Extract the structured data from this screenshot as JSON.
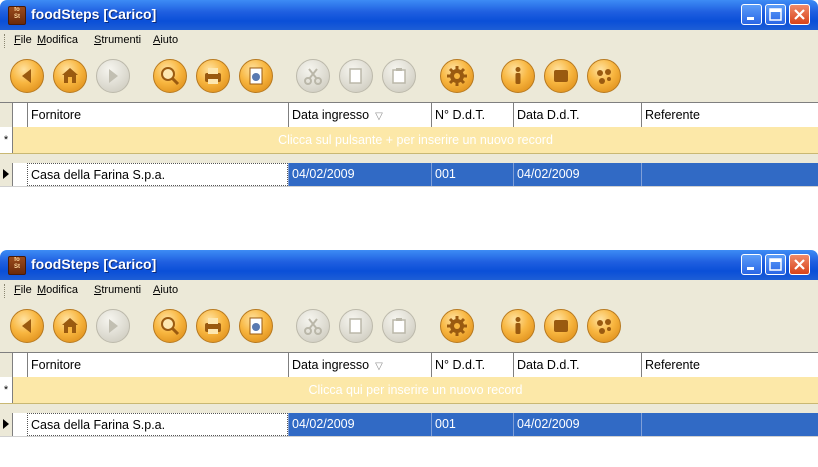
{
  "windows": [
    {
      "title": "foodSteps [Carico]",
      "app_icon_text": "food Steps",
      "menu": [
        "File",
        "Modifica",
        "Strumenti",
        "Aiuto"
      ],
      "toolbar_icons": [
        {
          "icon": "back-icon",
          "enabled": true
        },
        {
          "icon": "home-icon",
          "enabled": true
        },
        {
          "icon": "forward-icon",
          "enabled": false
        },
        {
          "icon": "search-icon",
          "enabled": true
        },
        {
          "icon": "print-icon",
          "enabled": true
        },
        {
          "icon": "preview-icon",
          "enabled": true
        },
        {
          "icon": "cut-icon",
          "enabled": false
        },
        {
          "icon": "copy-icon",
          "enabled": false
        },
        {
          "icon": "paste-icon",
          "enabled": false
        },
        {
          "icon": "settings-icon",
          "enabled": true
        },
        {
          "icon": "info-icon",
          "enabled": true
        },
        {
          "icon": "box-icon",
          "enabled": true
        },
        {
          "icon": "palette-icon",
          "enabled": true
        }
      ],
      "columns": [
        "Fornitore",
        "Data ingresso",
        "N° D.d.T.",
        "Data D.d.T.",
        "Referente"
      ],
      "sort_glyph": "▽",
      "new_row_star": "*",
      "new_row_hint": "Clicca sul pulsante + per inserire un nuovo record",
      "row": [
        "Casa della Farina S.p.a.",
        "04/02/2009",
        "001",
        "04/02/2009",
        ""
      ]
    },
    {
      "title": "foodSteps [Carico]",
      "app_icon_text": "food Steps",
      "menu": [
        "File",
        "Modifica",
        "Strumenti",
        "Aiuto"
      ],
      "toolbar_icons": [
        {
          "icon": "back-icon",
          "enabled": true
        },
        {
          "icon": "home-icon",
          "enabled": true
        },
        {
          "icon": "forward-icon",
          "enabled": false
        },
        {
          "icon": "search-icon",
          "enabled": true
        },
        {
          "icon": "print-icon",
          "enabled": true
        },
        {
          "icon": "preview-icon",
          "enabled": true
        },
        {
          "icon": "cut-icon",
          "enabled": false
        },
        {
          "icon": "copy-icon",
          "enabled": false
        },
        {
          "icon": "paste-icon",
          "enabled": false
        },
        {
          "icon": "settings-icon",
          "enabled": true
        },
        {
          "icon": "info-icon",
          "enabled": true
        },
        {
          "icon": "box-icon",
          "enabled": true
        },
        {
          "icon": "palette-icon",
          "enabled": true
        }
      ],
      "columns": [
        "Fornitore",
        "Data ingresso",
        "N° D.d.T.",
        "Data D.d.T.",
        "Referente"
      ],
      "sort_glyph": "▽",
      "new_row_star": "*",
      "new_row_hint": "Clicca qui per inserire un nuovo record",
      "row": [
        "Casa della Farina S.p.a.",
        "04/02/2009",
        "001",
        "04/02/2009",
        ""
      ]
    }
  ],
  "colors": {
    "title_bar": "#0a4fd8",
    "selection": "#316ac5",
    "new_row_background": "#fce8a8",
    "toolbar_button": "#f8b640",
    "menu_background": "#ece9d8"
  }
}
